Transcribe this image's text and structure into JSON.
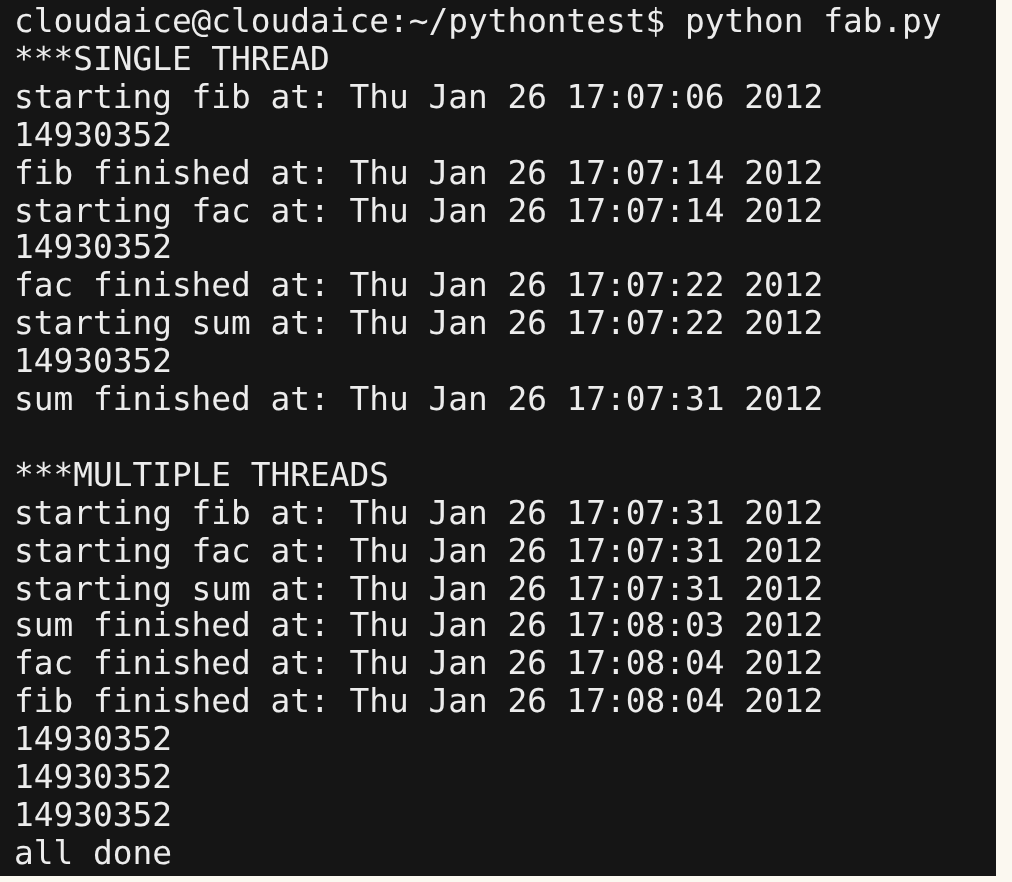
{
  "terminal": {
    "command_line": "cloudaice@cloudaice:~/pythontest$ python fab.py",
    "output_groups": [
      [
        "***SINGLE THREAD",
        "starting fib at: Thu Jan 26 17:07:06 2012",
        "14930352",
        "fib finished at: Thu Jan 26 17:07:14 2012",
        "starting fac at: Thu Jan 26 17:07:14 2012",
        "14930352",
        "fac finished at: Thu Jan 26 17:07:22 2012",
        "starting sum at: Thu Jan 26 17:07:22 2012",
        "14930352",
        "sum finished at: Thu Jan 26 17:07:31 2012"
      ],
      [
        "***MULTIPLE THREADS",
        "starting fib at: Thu Jan 26 17:07:31 2012",
        "starting fac at: Thu Jan 26 17:07:31 2012",
        "starting sum at: Thu Jan 26 17:07:31 2012",
        "sum finished at: Thu Jan 26 17:08:03 2012",
        "fac finished at: Thu Jan 26 17:08:04 2012",
        "fib finished at: Thu Jan 26 17:08:04 2012",
        "14930352",
        "14930352",
        "14930352",
        "all done"
      ]
    ]
  }
}
